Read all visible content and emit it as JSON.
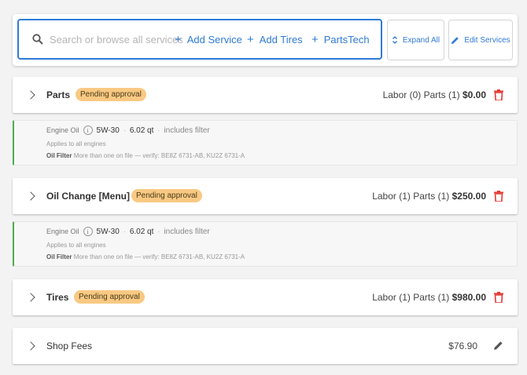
{
  "toolbar": {
    "search_placeholder": "Search or browse all services",
    "add_service": "Add Service",
    "add_tires": "Add Tires",
    "partstech": "PartsTech",
    "expand_all": "Expand All",
    "edit_services": "Edit Services"
  },
  "services": [
    {
      "title": "Parts",
      "badge": "Pending approval",
      "labor": "Labor (0)",
      "parts": "Parts (1)",
      "total": "$0.00"
    },
    {
      "title": "Oil Change [Menu]",
      "badge": "Pending approval",
      "labor": "Labor (1)",
      "parts": "Parts (1)",
      "total": "$250.00"
    },
    {
      "title": "Tires",
      "badge": "Pending approval",
      "labor": "Labor (1)",
      "parts": "Parts (1)",
      "total": "$980.00"
    }
  ],
  "shop_fees": {
    "title": "Shop Fees",
    "total": "$76.90"
  },
  "oil_detail": {
    "label": "Engine Oil",
    "info": "i",
    "viscosity": "5W-30",
    "sep": "·",
    "quantity": "6.02 qt",
    "filter_note": "includes filter",
    "applies": "Applies to all engines",
    "filter_key": "Oil Filter",
    "filter_value": "More than one on file — verify: BE8Z 6731-AB, KU2Z 6731-A"
  },
  "colors": {
    "accent": "#2f7bd6",
    "badge": "#f9c983",
    "trash": "#e53935",
    "detail_border": "#4caf50"
  },
  "icons": {
    "search": "search-icon",
    "expand": "expand-icon",
    "edit": "pencil-icon",
    "delete": "trash-icon",
    "chevron": "chevron-right-icon"
  }
}
